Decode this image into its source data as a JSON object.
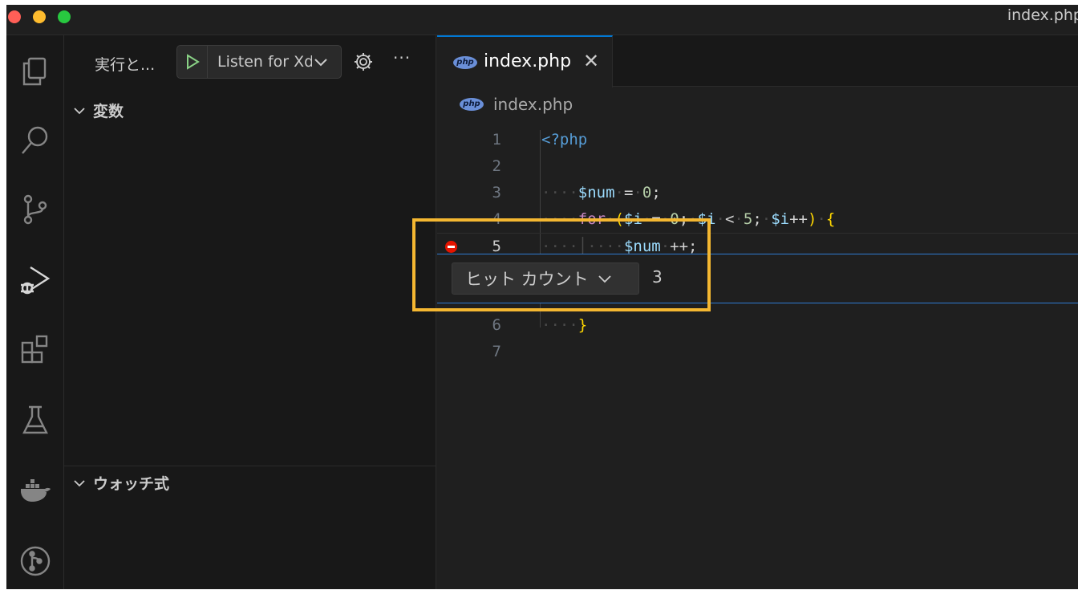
{
  "window": {
    "title": "index.php"
  },
  "activity_bar": {
    "items": [
      {
        "icon": "explorer-icon"
      },
      {
        "icon": "search-icon"
      },
      {
        "icon": "source-control-icon"
      },
      {
        "icon": "run-debug-icon",
        "active": true
      },
      {
        "icon": "extensions-icon"
      },
      {
        "icon": "testing-icon"
      },
      {
        "icon": "docker-icon"
      },
      {
        "icon": "git-graph-icon"
      }
    ]
  },
  "sidebar": {
    "run_label": "実行と...",
    "launch_config": "Listen for Xdebug",
    "sections": {
      "variables": "変数",
      "watch": "ウォッチ式"
    }
  },
  "editor": {
    "tab": {
      "label": "index.php",
      "icon": "php"
    },
    "breadcrumb": {
      "file": "index.php"
    },
    "lines": [
      {
        "number": "1",
        "text": "<?php"
      },
      {
        "number": "2",
        "text": ""
      },
      {
        "number": "3",
        "text": "$num = 0;"
      },
      {
        "number": "4",
        "text": "for ($i = 0; $i < 5; $i++) {"
      },
      {
        "number": "5",
        "text": "$num ++;",
        "breakpoint": true
      },
      {
        "number": "6",
        "text": "}"
      },
      {
        "number": "7",
        "text": ""
      }
    ],
    "breakpoint_widget": {
      "type_selected": "ヒット カウント",
      "value": "3"
    }
  },
  "colors": {
    "highlight_box": "#f4b731",
    "breakpoint": "#e51400",
    "accent": "#0078d4"
  }
}
